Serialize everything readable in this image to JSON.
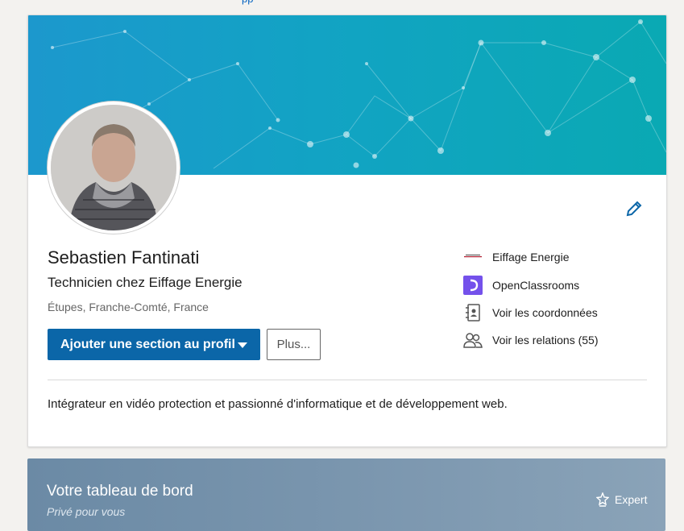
{
  "top_strip": {
    "text": "pp"
  },
  "profile": {
    "name": "Sebastien Fantinati",
    "headline": "Technicien chez Eiffage Energie",
    "location": "Étupes, Franche-Comté, France",
    "add_section_label": "Ajouter une section au profil",
    "more_label": "Plus...",
    "summary": "Intégrateur en vidéo protection et passionné d'informatique et de développement web.",
    "side_items": [
      {
        "label": "Eiffage Energie",
        "icon": "eiffage-logo-icon"
      },
      {
        "label": "OpenClassrooms",
        "icon": "openclassrooms-logo-icon"
      },
      {
        "label": "Voir les coordonnées",
        "icon": "contact-card-icon"
      },
      {
        "label": "Voir les relations (55)",
        "icon": "people-icon"
      }
    ]
  },
  "dashboard": {
    "title": "Votre tableau de bord",
    "subtitle": "Privé pour vous",
    "badge": "Expert"
  },
  "colors": {
    "primary": "#0b66a8",
    "banner_start": "#1c98cd",
    "banner_end": "#0aa9b3",
    "openclassrooms": "#7451eb"
  }
}
